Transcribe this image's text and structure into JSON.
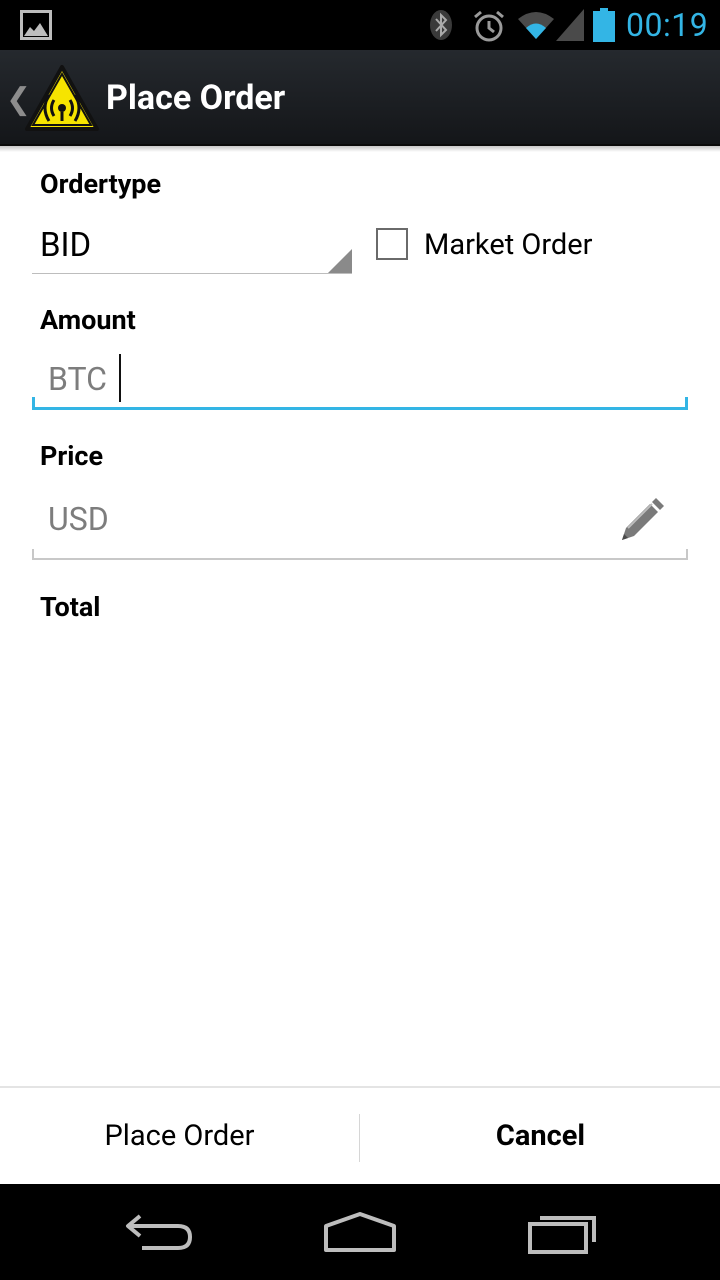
{
  "status_bar": {
    "time": "00:19",
    "icons": [
      "picture-icon",
      "bluetooth-icon",
      "alarm-icon",
      "wifi-icon",
      "signal-icon",
      "battery-icon"
    ],
    "accent_color": "#33b5e5"
  },
  "action_bar": {
    "title": "Place Order",
    "app_icon": "radio-warning-icon",
    "up_icon": "chevron-left-icon"
  },
  "form": {
    "ordertype": {
      "label": "Ordertype",
      "selected_value": "BID"
    },
    "market_order": {
      "label": "Market Order",
      "checked": false
    },
    "amount": {
      "label": "Amount",
      "value": "",
      "placeholder": "BTC",
      "focused": true
    },
    "price": {
      "label": "Price",
      "value": "",
      "placeholder": "USD",
      "edit_icon": "pencil-icon"
    },
    "total": {
      "label": "Total"
    }
  },
  "buttons": {
    "place_order": "Place Order",
    "cancel": "Cancel"
  },
  "nav_bar": {
    "icons": [
      "back-icon",
      "home-icon",
      "recents-icon"
    ]
  }
}
